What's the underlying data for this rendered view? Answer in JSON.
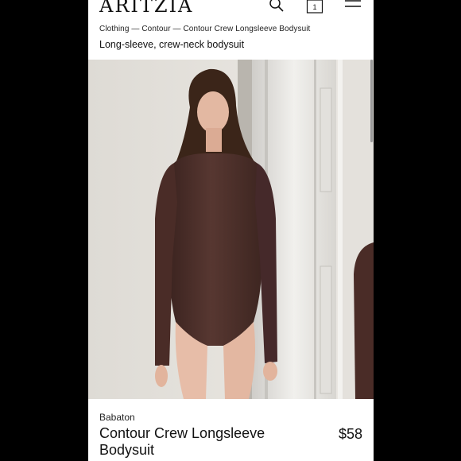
{
  "header": {
    "logo": "ARITZIA",
    "bag_count": "1",
    "icons": [
      "search-icon",
      "bag-icon",
      "menu-icon"
    ]
  },
  "breadcrumb": "Clothing — Contour — Contour Crew Longsleeve Bodysuit",
  "subtitle": "Long-sleeve, crew-neck bodysuit",
  "product": {
    "brand": "Babaton",
    "name": "Contour Crew Longsleeve Bodysuit",
    "price": "$58",
    "color": "#4b2e28"
  }
}
